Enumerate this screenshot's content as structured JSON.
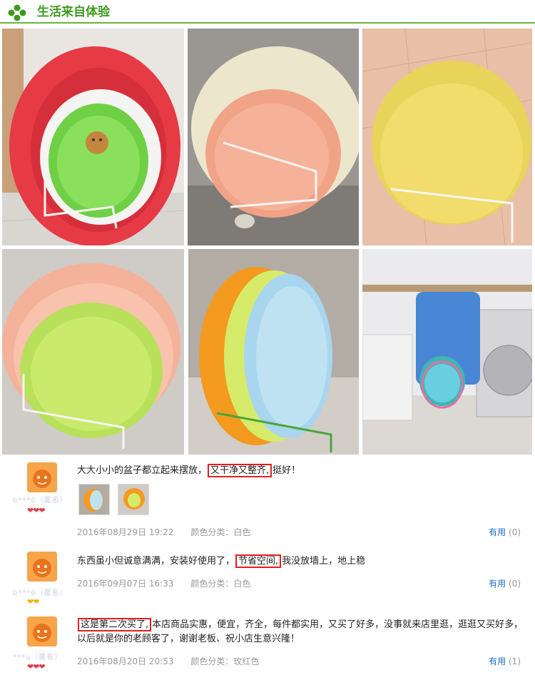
{
  "header": {
    "title": "生活来自体验",
    "logo_icon": "clover-icon",
    "accent": "#3c9a1c"
  },
  "photos": [
    {
      "name": "photo-red-basins-on-rack"
    },
    {
      "name": "photo-cream-pink-basins"
    },
    {
      "name": "photo-yellow-basin"
    },
    {
      "name": "photo-pink-green-basins"
    },
    {
      "name": "photo-orange-blue-basins"
    },
    {
      "name": "photo-laundry-room-basins"
    }
  ],
  "reviews": [
    {
      "user": "b***0（匿名）",
      "badges": "❤❤❤",
      "text_before": "大大小小的盆子都立起来摆放，",
      "text_highlight": "又干净又整齐,",
      "text_after": "挺好！",
      "date": "2016年08月29日 19:22",
      "color": "颜色分类：白色",
      "useful_label": "有用",
      "useful_count": "(0)"
    },
    {
      "user": "b***0（匿名）",
      "badges": "❤❤",
      "text_before": "东西虽小但诚意满满，安装好使用了，",
      "text_highlight": "节省空间,",
      "text_after": "我没放墙上，地上稳",
      "date": "2016年09月07日 16:33",
      "color": "颜色分类：白色",
      "useful_label": "有用",
      "useful_count": "(0)"
    },
    {
      "user": "***u（匿名）",
      "badges": "❤❤❤",
      "text_highlight": "这是第二次买了,",
      "text_after": "本店商品实惠，便宜，齐全，每件都实用，又买了好多，没事就来店里逛，逛逛又买好多，以后就是你的老顾客了，谢谢老板、祝小店生意兴隆！",
      "date": "2016年08月20日 20:53",
      "color": "颜色分类：玫红色",
      "useful_label": "有用",
      "useful_count": "(1)"
    }
  ]
}
